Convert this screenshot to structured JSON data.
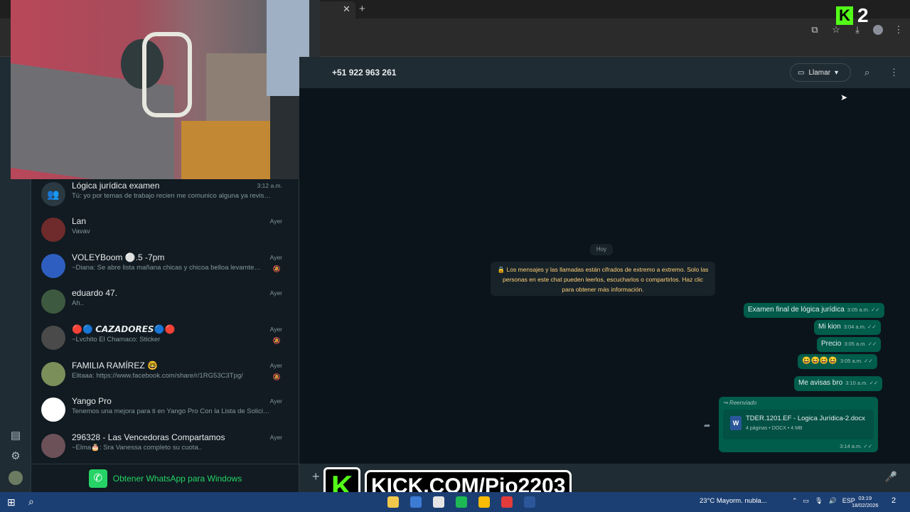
{
  "browser": {
    "tab_close": "✕",
    "tab_new": "+"
  },
  "kick_top": {
    "letter": "K",
    "number": "2"
  },
  "chat_list": {
    "items": [
      {
        "name": "Lógica jurídica examen",
        "time": "3:12 a.m.",
        "preview": "Tú: yo por temas de trabajo recien me comunico alguna ya reviso …",
        "muted": false
      },
      {
        "name": "Lan",
        "time": "Ayer",
        "preview": "Vavav",
        "muted": false
      },
      {
        "name": "VOLEYBoom ⚪.5 -7pm",
        "time": "Ayer",
        "preview": "~Diana: Se abre lista mañana chicas y chicoa belloa levamten su …",
        "muted": true
      },
      {
        "name": "eduardo 47.",
        "time": "Ayer",
        "preview": "Ah..",
        "muted": false
      },
      {
        "name": "🔴🔵 𝘾𝘼𝙕𝘼𝘿𝙊𝙍𝙀𝙎🔵🔴",
        "time": "Ayer",
        "preview": "~Lvchito  El Chamaco: Sticker",
        "muted": true
      },
      {
        "name": "FAMILIA RAMÍREZ 🤓",
        "time": "Ayer",
        "preview": "Elitaaa: https://www.facebook.com/share/r/1RG53C3Tpg/",
        "muted": true
      },
      {
        "name": "Yango Pro",
        "time": "Ayer",
        "preview": "Tenemos una mejora para ti en Yango Pro Con la Lista de Solicitudes…",
        "muted": false
      },
      {
        "name": "296328 - Las Vencedoras Compartamos",
        "time": "Ayer",
        "preview": "~Elma🎂: Sra Vanessa completo su cuota..",
        "muted": false
      }
    ],
    "get_app": "Obtener WhatsApp para Windows"
  },
  "chat": {
    "contact": "+51 922 963 261",
    "call_label": "Llamar",
    "day": "Hoy",
    "encryption": "🔒 Los mensajes y las llamadas están cifrados de extremo a extremo. Solo las personas en este chat pueden leerlos, escucharlos o compartirlos. Haz clic para obtener más información.",
    "messages": [
      {
        "text": "Examen final de lógica jurídica",
        "time": "3:05 a.m. ✓✓"
      },
      {
        "text": "Mi kion",
        "time": "3:04 a.m. ✓✓"
      },
      {
        "text": "Precio",
        "time": "3:05 a.m. ✓✓"
      },
      {
        "text": "😆😆😆😆",
        "time": "3:05 a.m. ✓✓"
      },
      {
        "text": "Me avisas bro",
        "time": "3:10 a.m. ✓✓"
      }
    ],
    "document": {
      "forwarded": "↪ Reenviado",
      "name": "TDER.1201.EF - Logica Jurídica-2.docx",
      "meta": "4 páginas • DOCX • 4 MB",
      "time": "3:14 a.m. ✓✓"
    }
  },
  "kick_banner": {
    "letter": "K",
    "text": "KICK.COM/Pio2203"
  },
  "taskbar": {
    "weather": "23°C  Mayorm. nubla...",
    "lang": "ESP",
    "time": "03:19",
    "date": "18/02/2026",
    "notifications": "2"
  }
}
